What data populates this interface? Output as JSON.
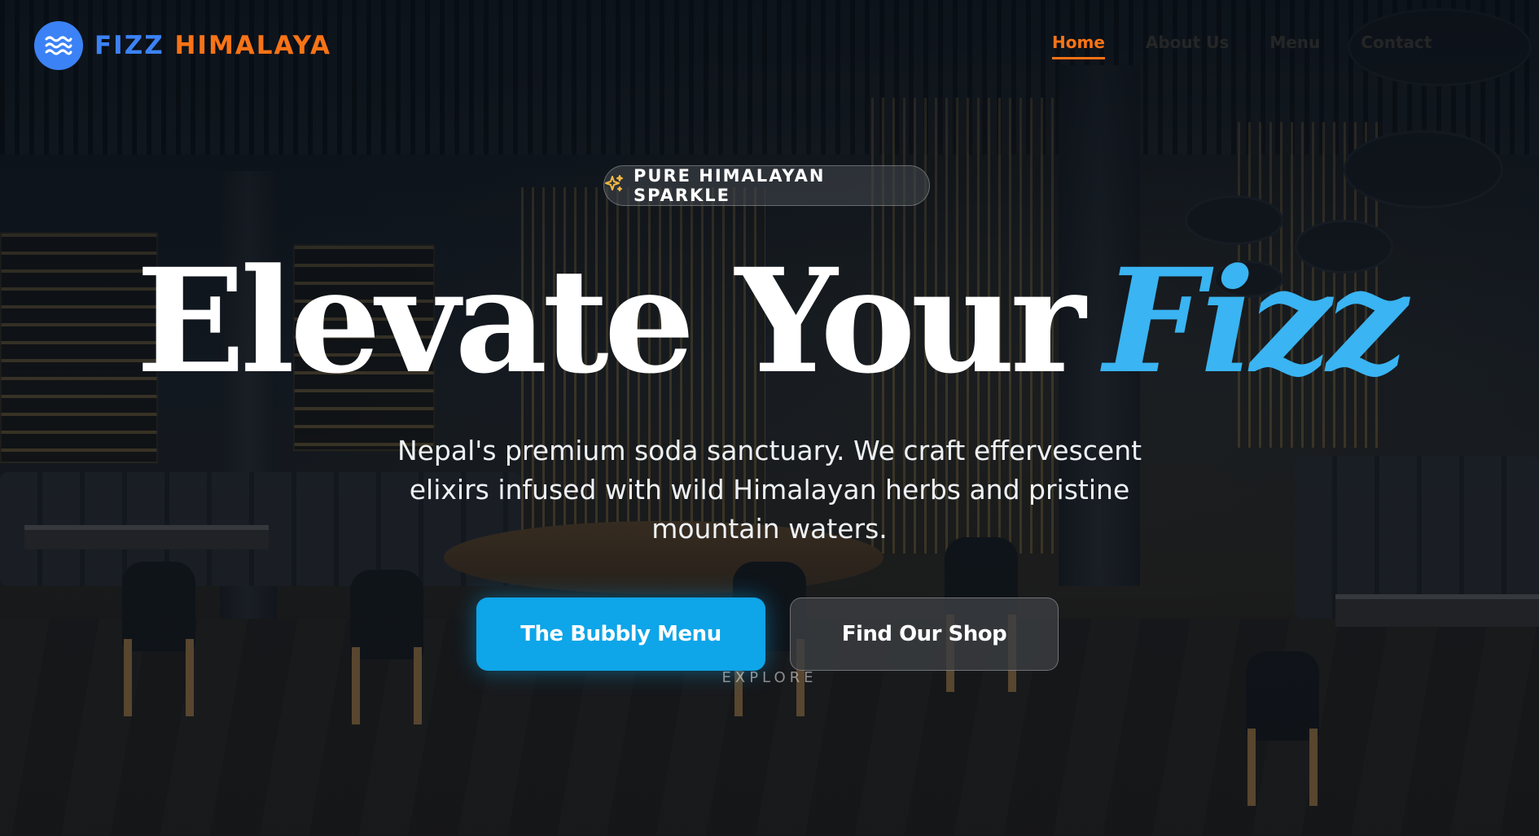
{
  "brand": {
    "name_part1": "FIZZ",
    "name_part2": "HIMALAYA",
    "icon": "waves-icon",
    "color_primary": "#3b82f6",
    "color_secondary": "#f97316"
  },
  "nav": {
    "items": [
      {
        "label": "Home",
        "active": true
      },
      {
        "label": "About Us",
        "active": false
      },
      {
        "label": "Menu",
        "active": false
      },
      {
        "label": "Contact",
        "active": false
      }
    ]
  },
  "hero": {
    "badge_icon": "sparkles-icon",
    "badge_text": "PURE HIMALAYAN SPARKLE",
    "headline_main": "Elevate Your",
    "headline_accent": "Fizz",
    "subtitle": "Nepal's premium soda sanctuary. We craft effervescent elixirs infused with wild Himalayan herbs and pristine mountain waters.",
    "primary_button": "The Bubbly Menu",
    "secondary_button": "Find Our Shop",
    "scroll_hint": "EXPLORE",
    "accent_color": "#3ab4f2",
    "button_color": "#0ea5e9"
  }
}
